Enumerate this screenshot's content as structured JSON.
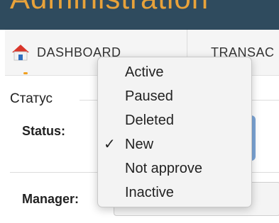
{
  "header": {
    "title": "Administration"
  },
  "nav": {
    "items": [
      {
        "label": "DASHBOARD"
      },
      {
        "label": "TRANSAC"
      }
    ]
  },
  "form": {
    "section_title": "Статус",
    "status_label": "Status:",
    "manager_label": "Manager:"
  },
  "dropdown": {
    "options": [
      {
        "label": "Active"
      },
      {
        "label": "Paused"
      },
      {
        "label": "Deleted"
      },
      {
        "label": "New",
        "checkmark": "✓"
      },
      {
        "label": "Not approve"
      },
      {
        "label": "Inactive"
      }
    ],
    "selected": "New"
  },
  "colors": {
    "title_bg": "#2f4b5e",
    "title_text": "#e8a23a",
    "select_accent": "#7ea6d8"
  }
}
